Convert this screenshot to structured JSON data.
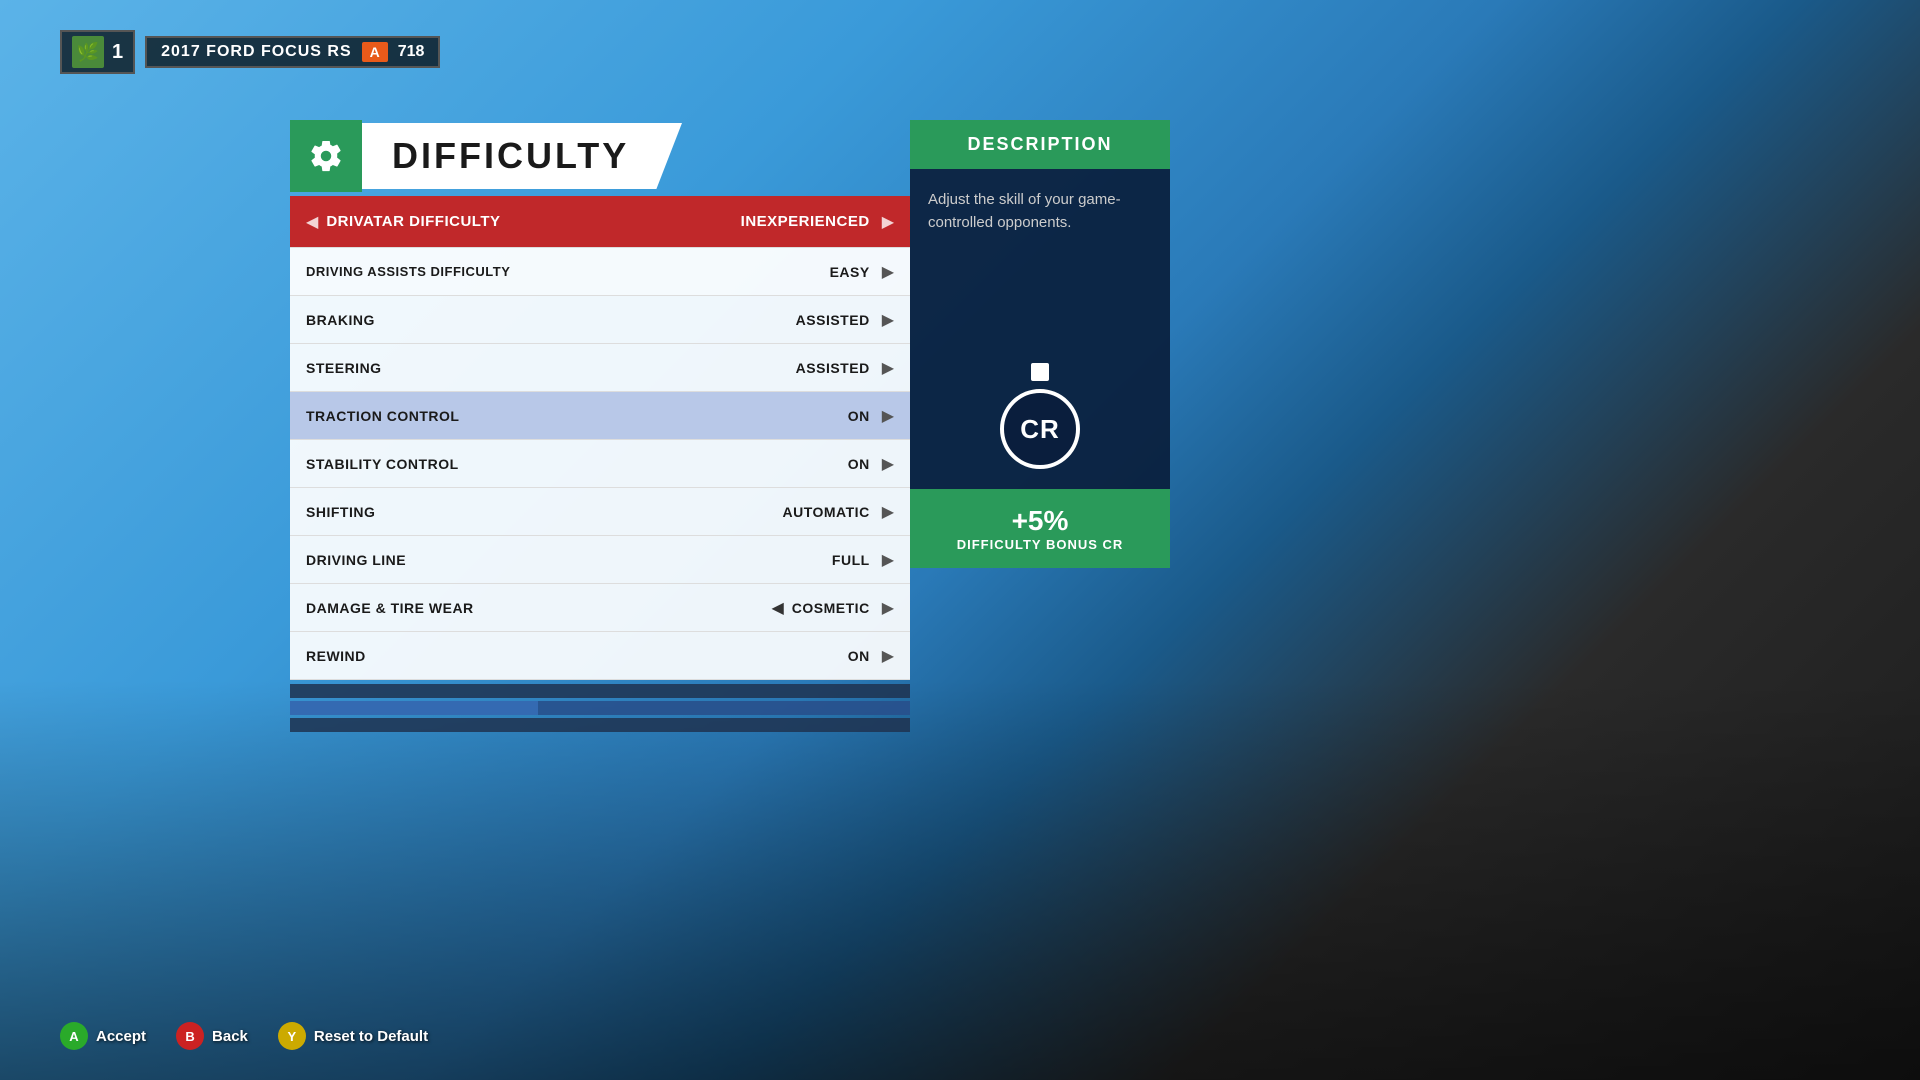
{
  "hud": {
    "player_number": "1",
    "car_name": "2017 FORD FOCUS RS",
    "car_class": "A",
    "car_pi": "718"
  },
  "difficulty": {
    "title": "DIFFICULTY",
    "settings": [
      {
        "label": "DRIVATAR DIFFICULTY",
        "value": "INEXPERIENCED",
        "type": "drivatar",
        "arrow_left": true,
        "arrow_right": true
      },
      {
        "label": "DRIVING ASSISTS DIFFICULTY",
        "value": "EASY",
        "type": "assists",
        "arrow_right": true
      },
      {
        "label": "BRAKING",
        "value": "ASSISTED",
        "type": "normal",
        "arrow_right": true
      },
      {
        "label": "STEERING",
        "value": "ASSISTED",
        "type": "normal",
        "arrow_right": true
      },
      {
        "label": "TRACTION CONTROL",
        "value": "ON",
        "type": "highlighted",
        "arrow_right": true
      },
      {
        "label": "STABILITY CONTROL",
        "value": "ON",
        "type": "normal",
        "arrow_right": true
      },
      {
        "label": "SHIFTING",
        "value": "AUTOMATIC",
        "type": "normal",
        "arrow_right": true
      },
      {
        "label": "DRIVING LINE",
        "value": "FULL",
        "type": "normal",
        "arrow_right": true
      },
      {
        "label": "DAMAGE & TIRE WEAR",
        "value": "COSMETIC",
        "type": "normal",
        "arrow_left": true,
        "arrow_right": true
      },
      {
        "label": "REWIND",
        "value": "ON",
        "type": "normal",
        "arrow_right": true
      }
    ]
  },
  "description": {
    "title": "DESCRIPTION",
    "text": "Adjust the skill of your game-controlled opponents.",
    "cr_label": "CR",
    "bonus_percent": "+5%",
    "bonus_label": "DIFFICULTY BONUS CR"
  },
  "controls": [
    {
      "button": "A",
      "label": "Accept",
      "color": "btn-a"
    },
    {
      "button": "B",
      "label": "Back",
      "color": "btn-b"
    },
    {
      "button": "Y",
      "label": "Reset to Default",
      "color": "btn-y"
    }
  ]
}
